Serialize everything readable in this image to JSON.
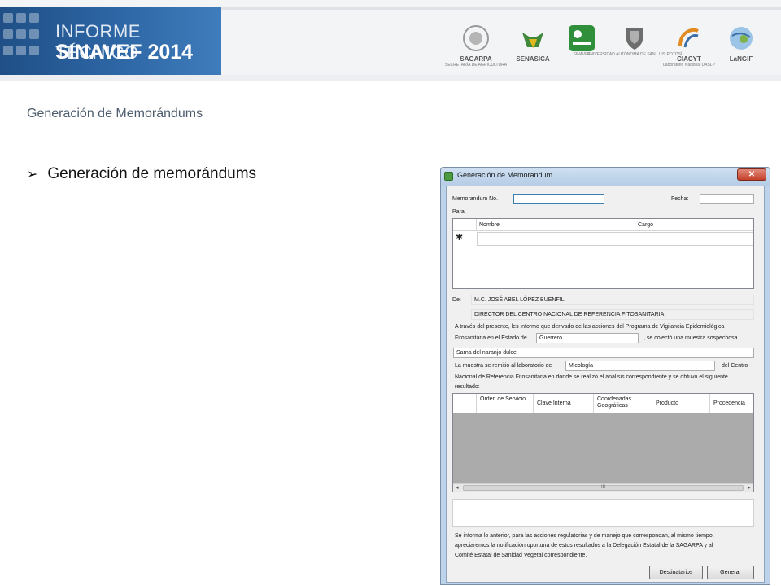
{
  "header": {
    "title_line1": "INFORME TÉCNICO",
    "title_line2": "SINAVEF 2014",
    "logos": [
      {
        "name": "SAGARPA",
        "sub": "SECRETARÍA DE AGRICULTURA",
        "color": "#9a9a9a",
        "icon": "eagle-seal-icon"
      },
      {
        "name": "SENASICA",
        "sub": "",
        "color": "#3f8a3a",
        "icon": "bull-icon"
      },
      {
        "name": "",
        "sub": "SINAVEF",
        "color": "#2f8f3a",
        "icon": "sinavef-box-icon"
      },
      {
        "name": "",
        "sub": "UNIVERSIDAD AUTÓNOMA DE SAN LUIS POTOSÍ",
        "color": "#5a5a5a",
        "icon": "shield-icon"
      },
      {
        "name": "CIACYT",
        "sub": "Laboratorio Nacional UASLP",
        "color": "#e08a1f",
        "icon": "ciacyt-icon"
      },
      {
        "name": "LaNGIF",
        "sub": "",
        "color": "#3a6fa8",
        "icon": "globe-icon"
      }
    ]
  },
  "section_title": "Generación de Memorándums",
  "bullet": {
    "arrow": "➢",
    "text": "Generación de memorándums"
  },
  "dialog": {
    "title": "Generación de Memorandum",
    "close_glyph": "✕",
    "memorandum_label": "Memorandum No.",
    "fecha_label": "Fecha:",
    "para_label": "Para:",
    "grid1": {
      "columns": [
        "Nombre",
        "Cargo"
      ],
      "new_row_marker": "✱"
    },
    "de_label": "De:",
    "de_name": "M.C. JOSÉ ABEL LÓPEZ BUENFIL",
    "de_title": "DIRECTOR DEL CENTRO NACIONAL DE REFERENCIA FITOSANITARIA",
    "text_line1": "A través del presente, les  informo que derivado de las acciones del Programa de Vigilancia Epidemiológica",
    "text_line2a": "Fitosanitaria en el Estado de",
    "estado_value": "Guerrero",
    "text_line2b": ", se colectó una muestra sospechosa",
    "sospechosa_value": "Sarna del naranjo dulce",
    "text_line3a": "La muestra se remitió al laboratorio de",
    "laboratorio_value": "Micología",
    "text_line3b": "del Centro",
    "text_line4": "Nacional de Referencia Fitosanitaria en donde se realizó el análisis correspondiente y se obtuvo el siguiente",
    "text_line5": "resultado:",
    "grid2": {
      "columns": [
        "Orden de Servicio",
        "Clave Interna",
        "Coordenadas Geográficas",
        "Producto",
        "Procedencia"
      ]
    },
    "scroll": {
      "left": "◂",
      "right": "▸",
      "thumb": "III"
    },
    "closing_line1": "Se informa lo anterior, para las acciones regulatorias y de manejo que correspondan, al mismo tiempo,",
    "closing_line2": "apreciaremos la notificación oportuna de estos resultados a la Delegación Estatal de la SAGARPA y al",
    "closing_line3": "Comité Estatal de Sanidad Vegetal correspondiente.",
    "btn_destinatarios": "Destinatarios",
    "btn_generar": "Generar"
  }
}
